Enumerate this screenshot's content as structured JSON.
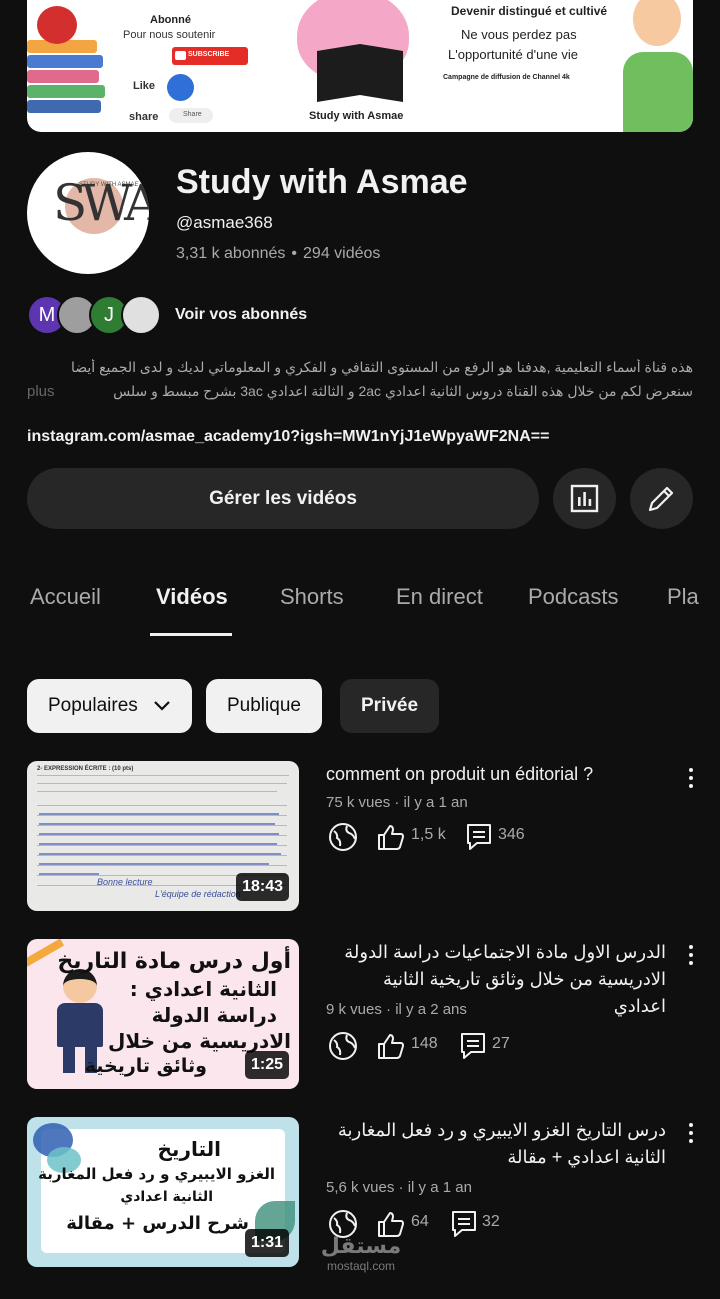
{
  "banner": {
    "abonne": "Abonné",
    "support": "Pour nous soutenir",
    "subscribe": "SUBSCRIBE",
    "like": "Like",
    "share": "share",
    "share_btn": "Share",
    "caption": "Study with Asmae",
    "right_line1": "Devenir distingué et cultivé",
    "right_line2": "Ne vous perdez pas",
    "right_line3": "L'opportunité d'une vie",
    "right_line4": "Campagne de diffusion de Channel 4k"
  },
  "channel": {
    "avatar_letters": "SWA",
    "avatar_tag": "STUDY WITH ASMAE",
    "name": "Study with Asmae",
    "handle": "@asmae368",
    "subscribers": "3,31 k abonnés",
    "separator": "•",
    "videos": "294 vidéos",
    "subs_label": "Voir vos abonnés",
    "sub_avatars": [
      {
        "letter": "M",
        "color": "#5e35b1"
      },
      {
        "letter": "",
        "color": "#9e9e9e"
      },
      {
        "letter": "J",
        "color": "#2e7d32"
      },
      {
        "letter": "",
        "color": "#e0e0e0"
      }
    ],
    "description_line1": "هذه قناة أسماء التعليمية ,هدفنا هو الرفع من المستوى الثقافي و الفكري و المعلوماتي لديك و لدى الجميع أيضا",
    "description_line2": "سنعرض لكم من خلال هذه القناة دروس الثانية اعدادي 2ac و الثالثة اعدادي 3ac بشرح مبسط و سلس",
    "more": "plus",
    "link": "instagram.com/asmae_academy10?igsh=MW1nYjJ1eWpyaWF2NA==",
    "manage_button": "Gérer les vidéos"
  },
  "tabs": [
    {
      "label": "Accueil",
      "active": false
    },
    {
      "label": "Vidéos",
      "active": true
    },
    {
      "label": "Shorts",
      "active": false
    },
    {
      "label": "En direct",
      "active": false
    },
    {
      "label": "Podcasts",
      "active": false
    },
    {
      "label": "Pla",
      "active": false
    }
  ],
  "filters": [
    {
      "label": "Populaires",
      "selected": false,
      "dropdown": true
    },
    {
      "label": "Publique",
      "selected": false
    },
    {
      "label": "Privée",
      "selected": true
    }
  ],
  "videos": [
    {
      "title": "comment on produit un éditorial ?",
      "meta": "75 k vues · il y a 1 an",
      "likes": "1,5 k",
      "comments": "346",
      "duration": "18:43",
      "thumb_text": [
        "2- EXPRESSION ÉCRITE : (10 pts)",
        "L'équipe de rédaction",
        "Bonne lecture"
      ]
    },
    {
      "title": "الدرس الاول مادة الاجتماعيات دراسة الدولة الادريسية من خلال وثائق تاريخية الثانية اعدادي",
      "meta": "9 k vues · il y a 2 ans",
      "likes": "148",
      "comments": "27",
      "duration": "1:25",
      "thumb_text": [
        "أول درس مادة التاريخ",
        "الثانية اعدادي :",
        "دراسة الدولة",
        "الادريسية من خلال",
        "وثائق تاريخية"
      ]
    },
    {
      "title": "درس التاريخ الغزو الايبيري و رد فعل المغاربة الثانية اعدادي + مقالة",
      "meta": "5,6 k vues · il y a 1 an",
      "likes": "64",
      "comments": "32",
      "duration": "1:31",
      "thumb_text": [
        "التاريخ",
        "الغزو الايبيري و رد فعل المغاربة",
        "الثانية اعدادي",
        "شرح الدرس + مقالة"
      ]
    }
  ],
  "watermark": {
    "arabic": "مستقل",
    "latin": "mostaql.com"
  },
  "colors": {
    "background": "#0f0f0f",
    "surface": "#272727",
    "text": "#f1f1f1",
    "muted": "#aaaaaa"
  }
}
